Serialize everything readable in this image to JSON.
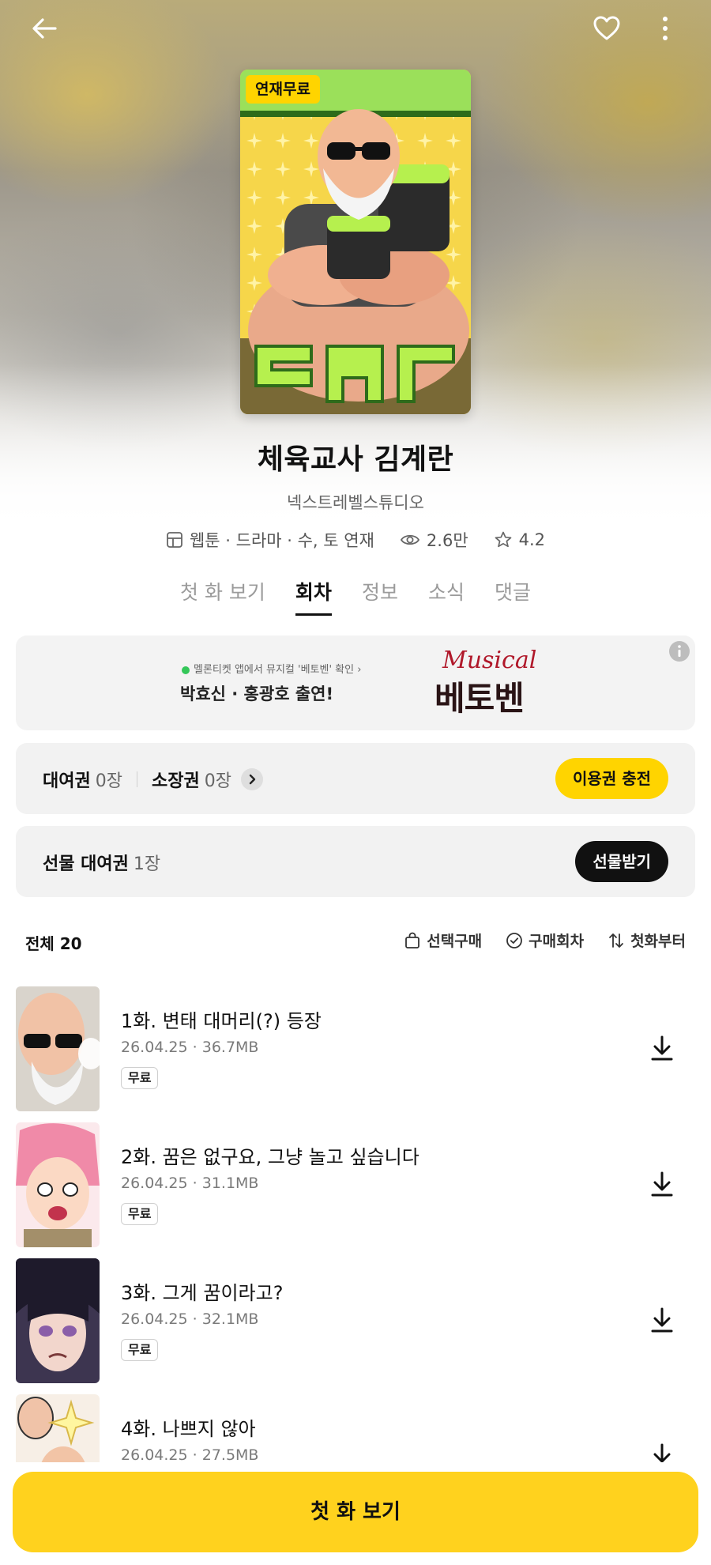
{
  "colors": {
    "accent_yellow": "#ffd400",
    "cta_yellow": "#ffd21e",
    "dark_button": "#111111",
    "card_bg": "#f2f2f2",
    "muted_text": "#7a7a7a"
  },
  "topbar": {
    "back_icon": "arrow-left-icon",
    "favorite_icon": "heart-outline-icon",
    "more_icon": "more-vertical-icon"
  },
  "cover": {
    "badge": "연재무료"
  },
  "work": {
    "title": "체육교사 김계란",
    "author": "넥스트레벨스튜디오",
    "genre": "웹툰 · 드라마 · 수, 토 연재",
    "views": "2.6만",
    "rating": "4.2"
  },
  "tabs": [
    {
      "label": "첫 화 보기",
      "active": false
    },
    {
      "label": "회차",
      "active": true
    },
    {
      "label": "정보",
      "active": false
    },
    {
      "label": "소식",
      "active": false
    },
    {
      "label": "댓글",
      "active": false
    }
  ],
  "banner": {
    "sub": "멜론티켓 앱에서 뮤지컬 '베토벤' 확인 ›",
    "main": "박효신 · 홍광호 출연!",
    "logo_script": "Musical",
    "logo_main": "베토벤"
  },
  "tickets": {
    "rental_label": "대여권",
    "rental_count": "0장",
    "owned_label": "소장권",
    "owned_count": "0장",
    "charge_button": "이용권 충전"
  },
  "gift": {
    "label": "선물 대여권",
    "count": "1장",
    "button": "선물받기"
  },
  "list": {
    "total": "전체 20",
    "select_buy": "선택구매",
    "purchased": "구매회차",
    "from_first": "첫화부터"
  },
  "episodes": [
    {
      "title": "1화. 변태 대머리(?) 등장",
      "date": "26.04.25",
      "size": "36.7MB",
      "badge": "무료"
    },
    {
      "title": "2화. 꿈은 없구요, 그냥 놀고 싶습니다",
      "date": "26.04.25",
      "size": "31.1MB",
      "badge": "무료"
    },
    {
      "title": "3화. 그게 꿈이라고?",
      "date": "26.04.25",
      "size": "32.1MB",
      "badge": "무료"
    },
    {
      "title": "4화. 나쁘지 않아",
      "date": "26.04.25",
      "size": "27.5MB",
      "badge": ""
    }
  ],
  "cta": {
    "label": "첫 화 보기"
  }
}
